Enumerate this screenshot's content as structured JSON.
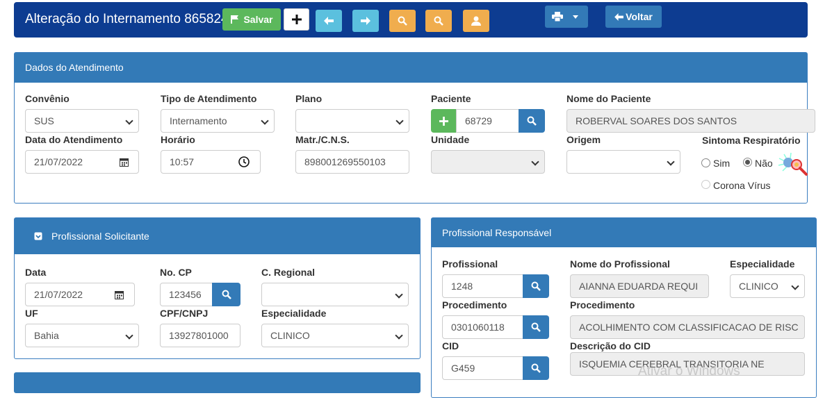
{
  "header": {
    "title": "Alteração do Internamento 865824",
    "save_label": "Salvar",
    "back_label": "Voltar"
  },
  "colors": {
    "header_bg": "#0d3c91",
    "panel_header": "#337ab7",
    "save_green": "#5cb85c",
    "nav_cyan": "#5bc0de",
    "search_orange": "#f0ad4e"
  },
  "dados": {
    "heading": "Dados do Atendimento",
    "convenio": {
      "label": "Convênio",
      "value": "SUS"
    },
    "tipo": {
      "label": "Tipo de Atendimento",
      "value": "Internamento"
    },
    "plano": {
      "label": "Plano",
      "value": ""
    },
    "paciente": {
      "label": "Paciente",
      "value": "68729"
    },
    "nome_paciente": {
      "label": "Nome do Paciente",
      "value": "ROBERVAL SOARES DOS SANTOS"
    },
    "data": {
      "label": "Data do Atendimento",
      "value": "21/07/2022"
    },
    "horario": {
      "label": "Horário",
      "value": "10:57"
    },
    "matr": {
      "label": "Matr./C.N.S.",
      "value": "898001269550103"
    },
    "unidade": {
      "label": "Unidade",
      "value": ""
    },
    "origem": {
      "label": "Origem",
      "value": ""
    },
    "sintoma": {
      "label": "Sintoma Respiratório",
      "sim": "Sim",
      "nao": "Não",
      "corona": "Corona Vírus",
      "selected": "Não"
    }
  },
  "solicitante": {
    "heading": "Profissional Solicitante",
    "data": {
      "label": "Data",
      "value": "21/07/2022"
    },
    "cp": {
      "label": "No. CP",
      "value": "123456"
    },
    "regional": {
      "label": "C. Regional",
      "value": ""
    },
    "uf": {
      "label": "UF",
      "value": "Bahia"
    },
    "cpf": {
      "label": "CPF/CNPJ",
      "value": "13927801000"
    },
    "especialidade": {
      "label": "Especialidade",
      "value": "CLINICO"
    }
  },
  "responsavel": {
    "heading": "Profissional Responsável",
    "profissional": {
      "label": "Profissional",
      "value": "1248"
    },
    "nome": {
      "label": "Nome do Profissional",
      "value": "AIANNA EDUARDA REQUI"
    },
    "especialidade": {
      "label": "Especialidade",
      "value": "CLINICO"
    },
    "procedimento_cod": {
      "label": "Procedimento",
      "value": "0301060118"
    },
    "procedimento_desc": {
      "label": "Procedimento",
      "value": "ACOLHIMENTO COM CLASSIFICACAO DE RISC"
    },
    "cid": {
      "label": "CID",
      "value": "G459"
    },
    "cid_desc": {
      "label": "Descrição do CID",
      "value": "ISQUEMIA CEREBRAL TRANSITORIA NE"
    }
  },
  "watermark": "Ativar o Windows"
}
